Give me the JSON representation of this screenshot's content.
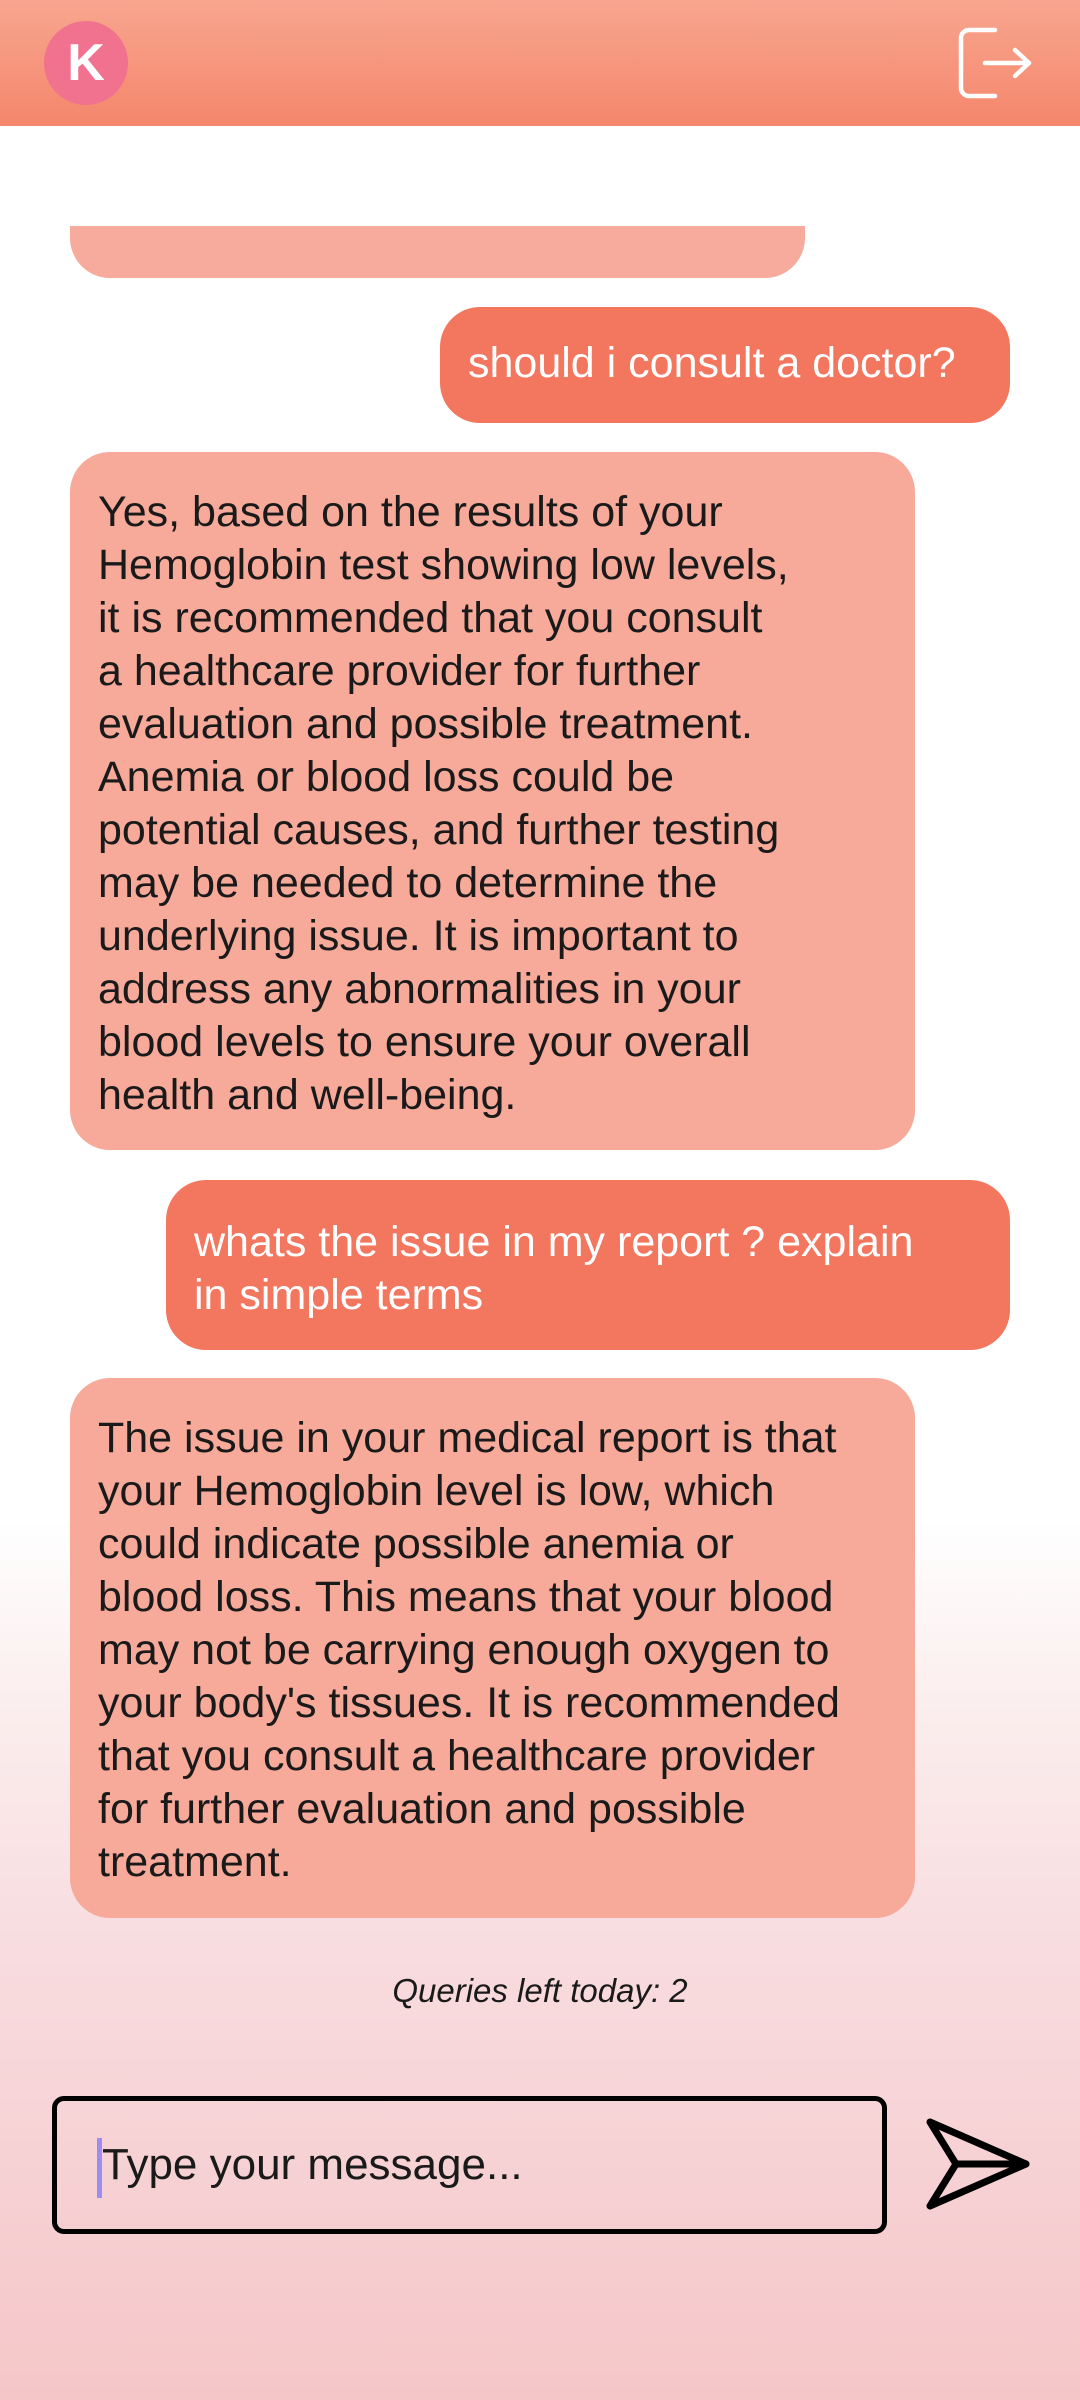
{
  "header": {
    "avatar_letter": "K",
    "icons": {
      "logout": "logout-icon"
    },
    "colors": {
      "top": "#f8a68f",
      "bottom": "#f4866c",
      "avatar": "#f0728f"
    }
  },
  "messages": [
    {
      "role": "user",
      "text": "should i consult a doctor?"
    },
    {
      "role": "bot",
      "text": "Yes, based on the results of your\nHemoglobin test showing low levels,\nit is recommended that you consult\na healthcare provider for further\nevaluation and possible treatment.\nAnemia or blood loss could be\npotential causes, and further testing\nmay be needed to determine the\nunderlying issue. It is important to\naddress any abnormalities in your\nblood levels to ensure your overall\nhealth and well-being."
    },
    {
      "role": "user",
      "text": "whats the issue in my report ? explain\nin simple terms"
    },
    {
      "role": "bot",
      "text": "The issue in your medical report is that\nyour Hemoglobin level is low, which\ncould indicate possible anemia or\nblood loss. This means that your blood\nmay not be carrying enough oxygen to\nyour body's tissues. It is recommended\nthat you consult a healthcare provider\nfor further evaluation and possible\ntreatment."
    }
  ],
  "bubble_colors": {
    "user": "#f3765f",
    "bot": "#f7a99a"
  },
  "queries_left": "Queries left today: 2",
  "composer": {
    "placeholder": "Type your message...",
    "icons": {
      "send": "send-icon"
    }
  }
}
